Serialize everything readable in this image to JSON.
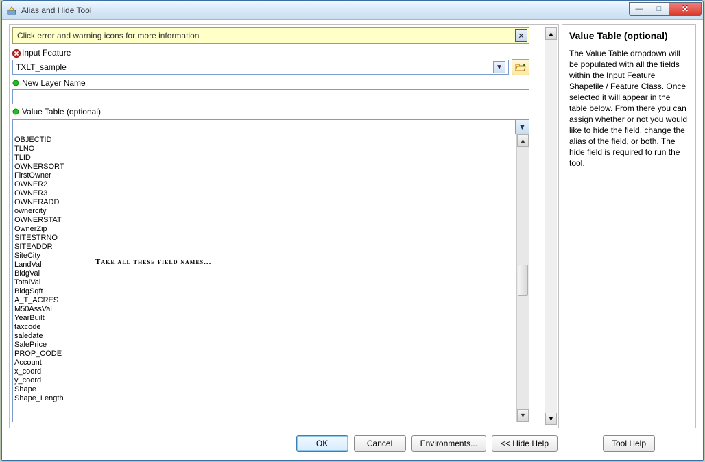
{
  "window": {
    "title": "Alias and Hide Tool"
  },
  "message_bar": {
    "text": "Click error and warning icons for more information"
  },
  "params": {
    "input_feature": {
      "label": "Input Feature",
      "value": "TXLT_sample"
    },
    "new_layer_name": {
      "label": "New Layer Name",
      "value": ""
    },
    "value_table": {
      "label": "Value Table (optional)"
    }
  },
  "field_list": [
    "OBJECTID",
    "TLNO",
    "TLID",
    "OWNERSORT",
    "FirstOwner",
    "OWNER2",
    "OWNER3",
    "OWNERADD",
    "ownercity",
    "OWNERSTAT",
    "OwnerZip",
    "SITESTRNO",
    "SITEADDR",
    "SiteCity",
    "LandVal",
    "BldgVal",
    "TotalVal",
    "BldgSqft",
    "A_T_ACRES",
    "M50AssVal",
    "YearBuilt",
    "taxcode",
    "saledate",
    "SalePrice",
    "PROP_CODE",
    "Account",
    "x_coord",
    "y_coord",
    "Shape",
    "Shape_Length"
  ],
  "overlay": "Take all these field names...",
  "help": {
    "title": "Value Table (optional)",
    "body": "The Value Table dropdown will be populated with all the fields within the Input Feature Shapefile / Feature Class. Once selected it will appear in the table below. From there you can assign whether or not you would like to hide the field, change the alias of the field, or both. The hide field is required to run the tool."
  },
  "buttons": {
    "ok": "OK",
    "cancel": "Cancel",
    "environments": "Environments...",
    "hide_help": "<< Hide Help",
    "tool_help": "Tool Help"
  },
  "icons": {
    "dropdown_arrow": "▼",
    "close_x": "✕",
    "minimize": "—",
    "maximize": "□",
    "up": "▲",
    "down": "▼"
  }
}
